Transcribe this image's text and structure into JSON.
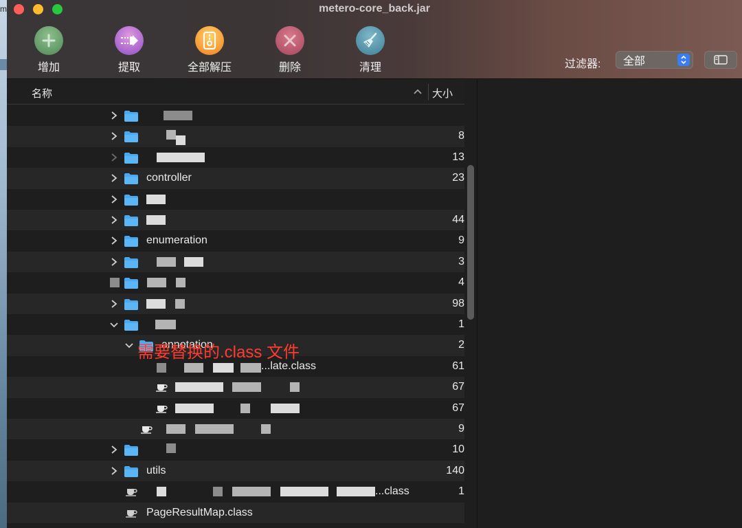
{
  "desktop": {
    "fragment": "m"
  },
  "window": {
    "title": "metero-core_back.jar"
  },
  "toolbar": {
    "buttons": [
      {
        "id": "add",
        "label": "增加",
        "icon": "plus-icon"
      },
      {
        "id": "extract",
        "label": "提取",
        "icon": "extract-arrow-icon"
      },
      {
        "id": "extract_all",
        "label": "全部解压",
        "icon": "zip-archive-icon"
      },
      {
        "id": "delete",
        "label": "删除",
        "icon": "x-icon"
      },
      {
        "id": "clean",
        "label": "清理",
        "icon": "broom-icon"
      }
    ],
    "filter_label": "过滤器:",
    "filter_value": "全部"
  },
  "columns": {
    "name": "名称",
    "size": "大小"
  },
  "rows": [
    {
      "name": "",
      "size": "",
      "expanded": false,
      "type": "folder",
      "level": 1
    },
    {
      "name": "",
      "size": "8",
      "expanded": false,
      "type": "folder",
      "level": 1
    },
    {
      "name": "",
      "size": "13",
      "expanded": false,
      "type": "folder",
      "level": 1
    },
    {
      "name": "controller",
      "size": "23",
      "expanded": false,
      "type": "folder",
      "level": 1
    },
    {
      "name": "",
      "size": "",
      "expanded": false,
      "type": "folder",
      "level": 1
    },
    {
      "name": "",
      "size": "44",
      "expanded": false,
      "type": "folder",
      "level": 1
    },
    {
      "name": "enumeration",
      "size": "9",
      "expanded": false,
      "type": "folder",
      "level": 1
    },
    {
      "name": "",
      "size": "3",
      "expanded": false,
      "type": "folder",
      "level": 1
    },
    {
      "name": "",
      "size": "4",
      "expanded": false,
      "type": "folder",
      "level": 1
    },
    {
      "name": "",
      "size": "98",
      "expanded": false,
      "type": "folder",
      "level": 1
    },
    {
      "name": "",
      "size": "1",
      "expanded": true,
      "type": "folder",
      "level": 1
    },
    {
      "name": "annotation",
      "size": "2",
      "expanded": true,
      "type": "folder",
      "level": 2
    },
    {
      "name": "...late.class",
      "size": "61",
      "expanded": false,
      "type": "class",
      "level": 3
    },
    {
      "name": "",
      "size": "67",
      "expanded": false,
      "type": "class",
      "level": 3
    },
    {
      "name": "",
      "size": "67",
      "expanded": false,
      "type": "class",
      "level": 3
    },
    {
      "name": "",
      "size": "9",
      "expanded": false,
      "type": "class",
      "level": 2
    },
    {
      "name": "",
      "size": "10",
      "expanded": false,
      "type": "folder",
      "level": 1
    },
    {
      "name": "utils",
      "size": "140",
      "expanded": false,
      "type": "folder",
      "level": 1
    },
    {
      "name": "...class",
      "size": "1",
      "expanded": false,
      "type": "class",
      "level": 1
    },
    {
      "name": "PageResultMap.class",
      "size": "",
      "expanded": false,
      "type": "class",
      "level": 1
    }
  ],
  "annotation_text": "需要替换的.class 文件",
  "colors": {
    "folder": "#4aa8f0",
    "annotation": "#ff3b30",
    "selector_accent": "#3b7cf0"
  }
}
